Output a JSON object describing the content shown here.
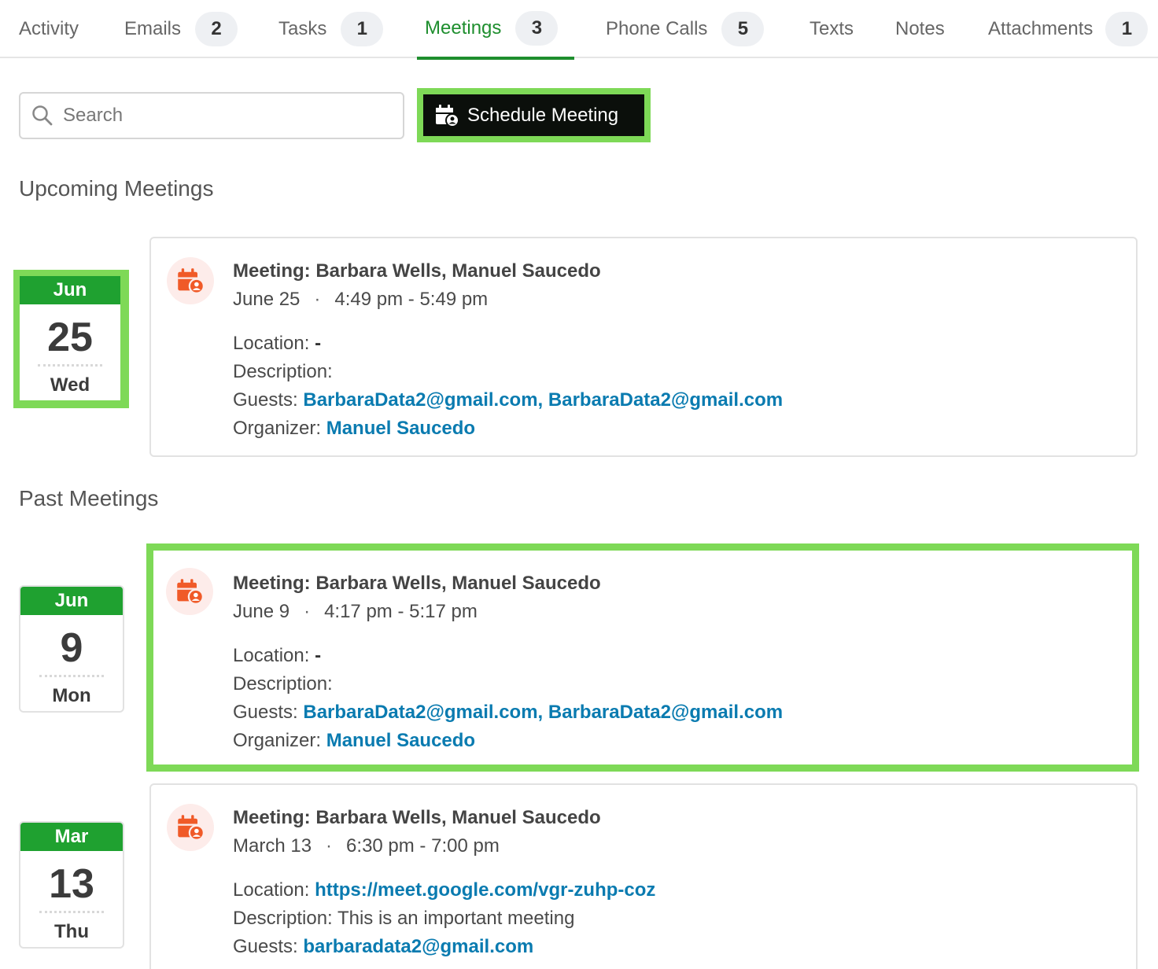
{
  "tabs": [
    {
      "label": "Activity",
      "count": ""
    },
    {
      "label": "Emails",
      "count": "2"
    },
    {
      "label": "Tasks",
      "count": "1"
    },
    {
      "label": "Meetings",
      "count": "3"
    },
    {
      "label": "Phone Calls",
      "count": "5"
    },
    {
      "label": "Texts",
      "count": ""
    },
    {
      "label": "Notes",
      "count": ""
    },
    {
      "label": "Attachments",
      "count": "1"
    }
  ],
  "active_tab": "Meetings",
  "colors": {
    "accent": "#1e8e2e",
    "highlight": "#7ed957",
    "link": "#0a7bb0",
    "icon": "#f05a28"
  },
  "search": {
    "placeholder": "Search"
  },
  "schedule_button": {
    "label": "Schedule Meeting",
    "icon": "calendar-user-icon"
  },
  "sections": {
    "upcoming": "Upcoming Meetings",
    "past": "Past Meetings"
  },
  "labels": {
    "location": "Location:",
    "description": "Description:",
    "guests": "Guests:",
    "organizer": "Organizer:",
    "separator": "·"
  },
  "meetings": [
    {
      "month": "Jun",
      "day": "25",
      "weekday": "Wed",
      "title": "Meeting: Barbara Wells, Manuel Saucedo",
      "date": "June 25",
      "time": "4:49 pm - 5:49 pm",
      "location": "-",
      "description": "",
      "guests": "BarbaraData2@gmail.com, BarbaraData2@gmail.com",
      "organizer": "Manuel Saucedo"
    },
    {
      "month": "Jun",
      "day": "9",
      "weekday": "Mon",
      "title": "Meeting: Barbara Wells, Manuel Saucedo",
      "date": "June 9",
      "time": "4:17 pm - 5:17 pm",
      "location": "-",
      "description": "",
      "guests": "BarbaraData2@gmail.com, BarbaraData2@gmail.com",
      "organizer": "Manuel Saucedo"
    },
    {
      "month": "Mar",
      "day": "13",
      "weekday": "Thu",
      "title": "Meeting: Barbara Wells, Manuel Saucedo",
      "date": "March 13",
      "time": "6:30 pm - 7:00 pm",
      "location": "https://meet.google.com/vgr-zuhp-coz",
      "description": "This is an important meeting",
      "guests": "barbaradata2@gmail.com"
    }
  ]
}
